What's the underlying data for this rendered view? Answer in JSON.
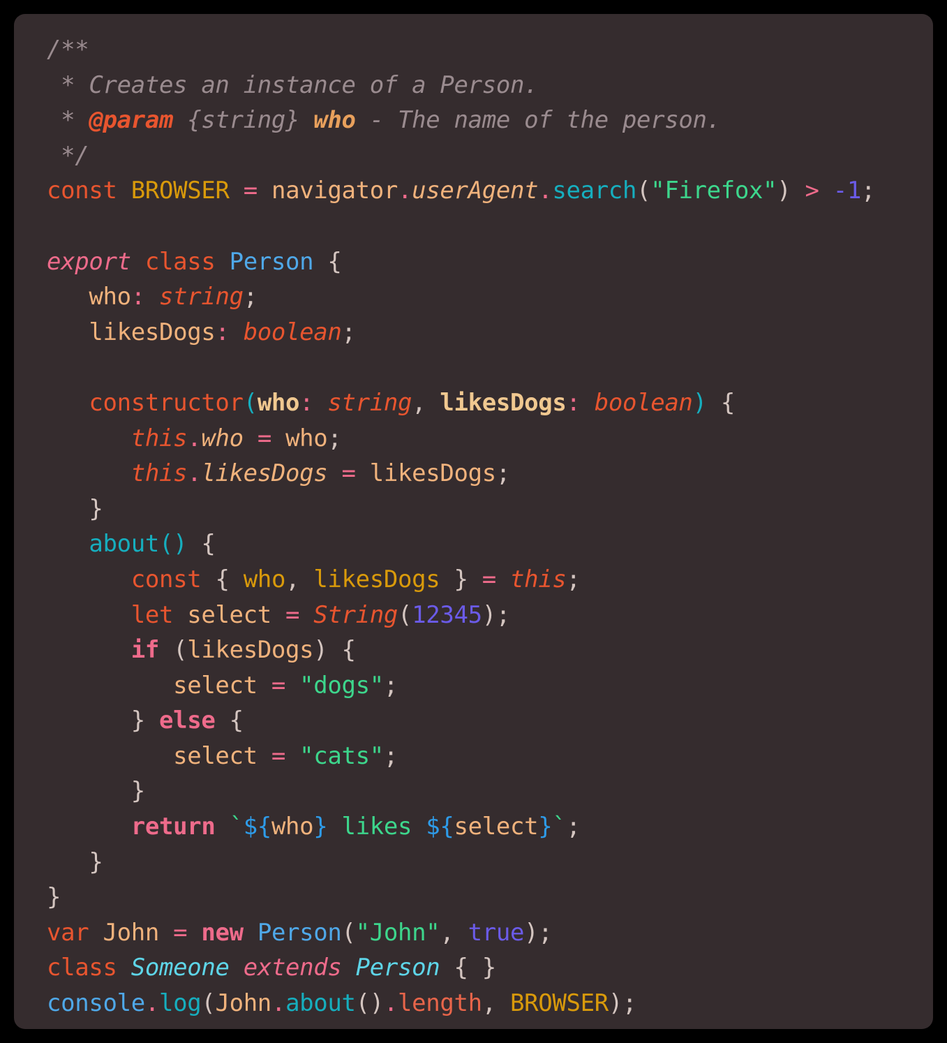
{
  "card": {
    "background_color": "#352C2E",
    "outer_background_color": "#000000",
    "corner_radius_px": 16,
    "language": "typescript"
  },
  "theme": {
    "foreground": "#D6C6C1",
    "comment": "#9A8B8F",
    "keyword_orange": "#E8552F",
    "keyword_pink": "#EE6B8B",
    "variable_tan": "#F0B27C",
    "constant_gold": "#D99A0B",
    "class_blue": "#4FA8E8",
    "function_cyan": "#16AEBE",
    "string_green": "#3DD68C",
    "number_purple": "#6B5BE8",
    "punctuation": "#D4C5C0"
  },
  "code": {
    "lines": [
      "/**",
      " * Creates an instance of a Person.",
      " * @param {string} who - The name of the person.",
      " */",
      "const BROWSER = navigator.userAgent.search(\"Firefox\") > -1;",
      "",
      "export class Person {",
      "   who: string;",
      "   likesDogs: boolean;",
      "",
      "   constructor(who: string, likesDogs: boolean) {",
      "      this.who = who;",
      "      this.likesDogs = likesDogs;",
      "   }",
      "   about() {",
      "      const { who, likesDogs } = this;",
      "      let select = String(12345);",
      "      if (likesDogs) {",
      "         select = \"dogs\";",
      "      } else {",
      "         select = \"cats\";",
      "      }",
      "      return `${who} likes ${select}`;",
      "   }",
      "}",
      "var John = new Person(\"John\", true);",
      "class Someone extends Person { }",
      "console.log(John.about().length, BROWSER);"
    ],
    "identifiers": {
      "class_name": "Person",
      "subclass_name": "Someone",
      "instance_name": "John",
      "method_name": "about",
      "constant_name": "BROWSER",
      "fields": [
        "who",
        "likesDogs"
      ],
      "local_variable": "select"
    },
    "literals": {
      "browser_match": "Firefox",
      "browser_compare": "-1",
      "string_number": "12345",
      "dogs_value": "dogs",
      "cats_value": "cats",
      "person_arg": "John",
      "likes_dogs_arg": "true",
      "template_literal": "`${who} likes ${select}`"
    },
    "jsdoc": {
      "open": "/**",
      "description": " * Creates an instance of a Person.",
      "param_line": " * @param {string} who - The name of the person.",
      "param_tag": "@param",
      "param_type": "{string}",
      "param_name": "who",
      "close": " */"
    }
  }
}
